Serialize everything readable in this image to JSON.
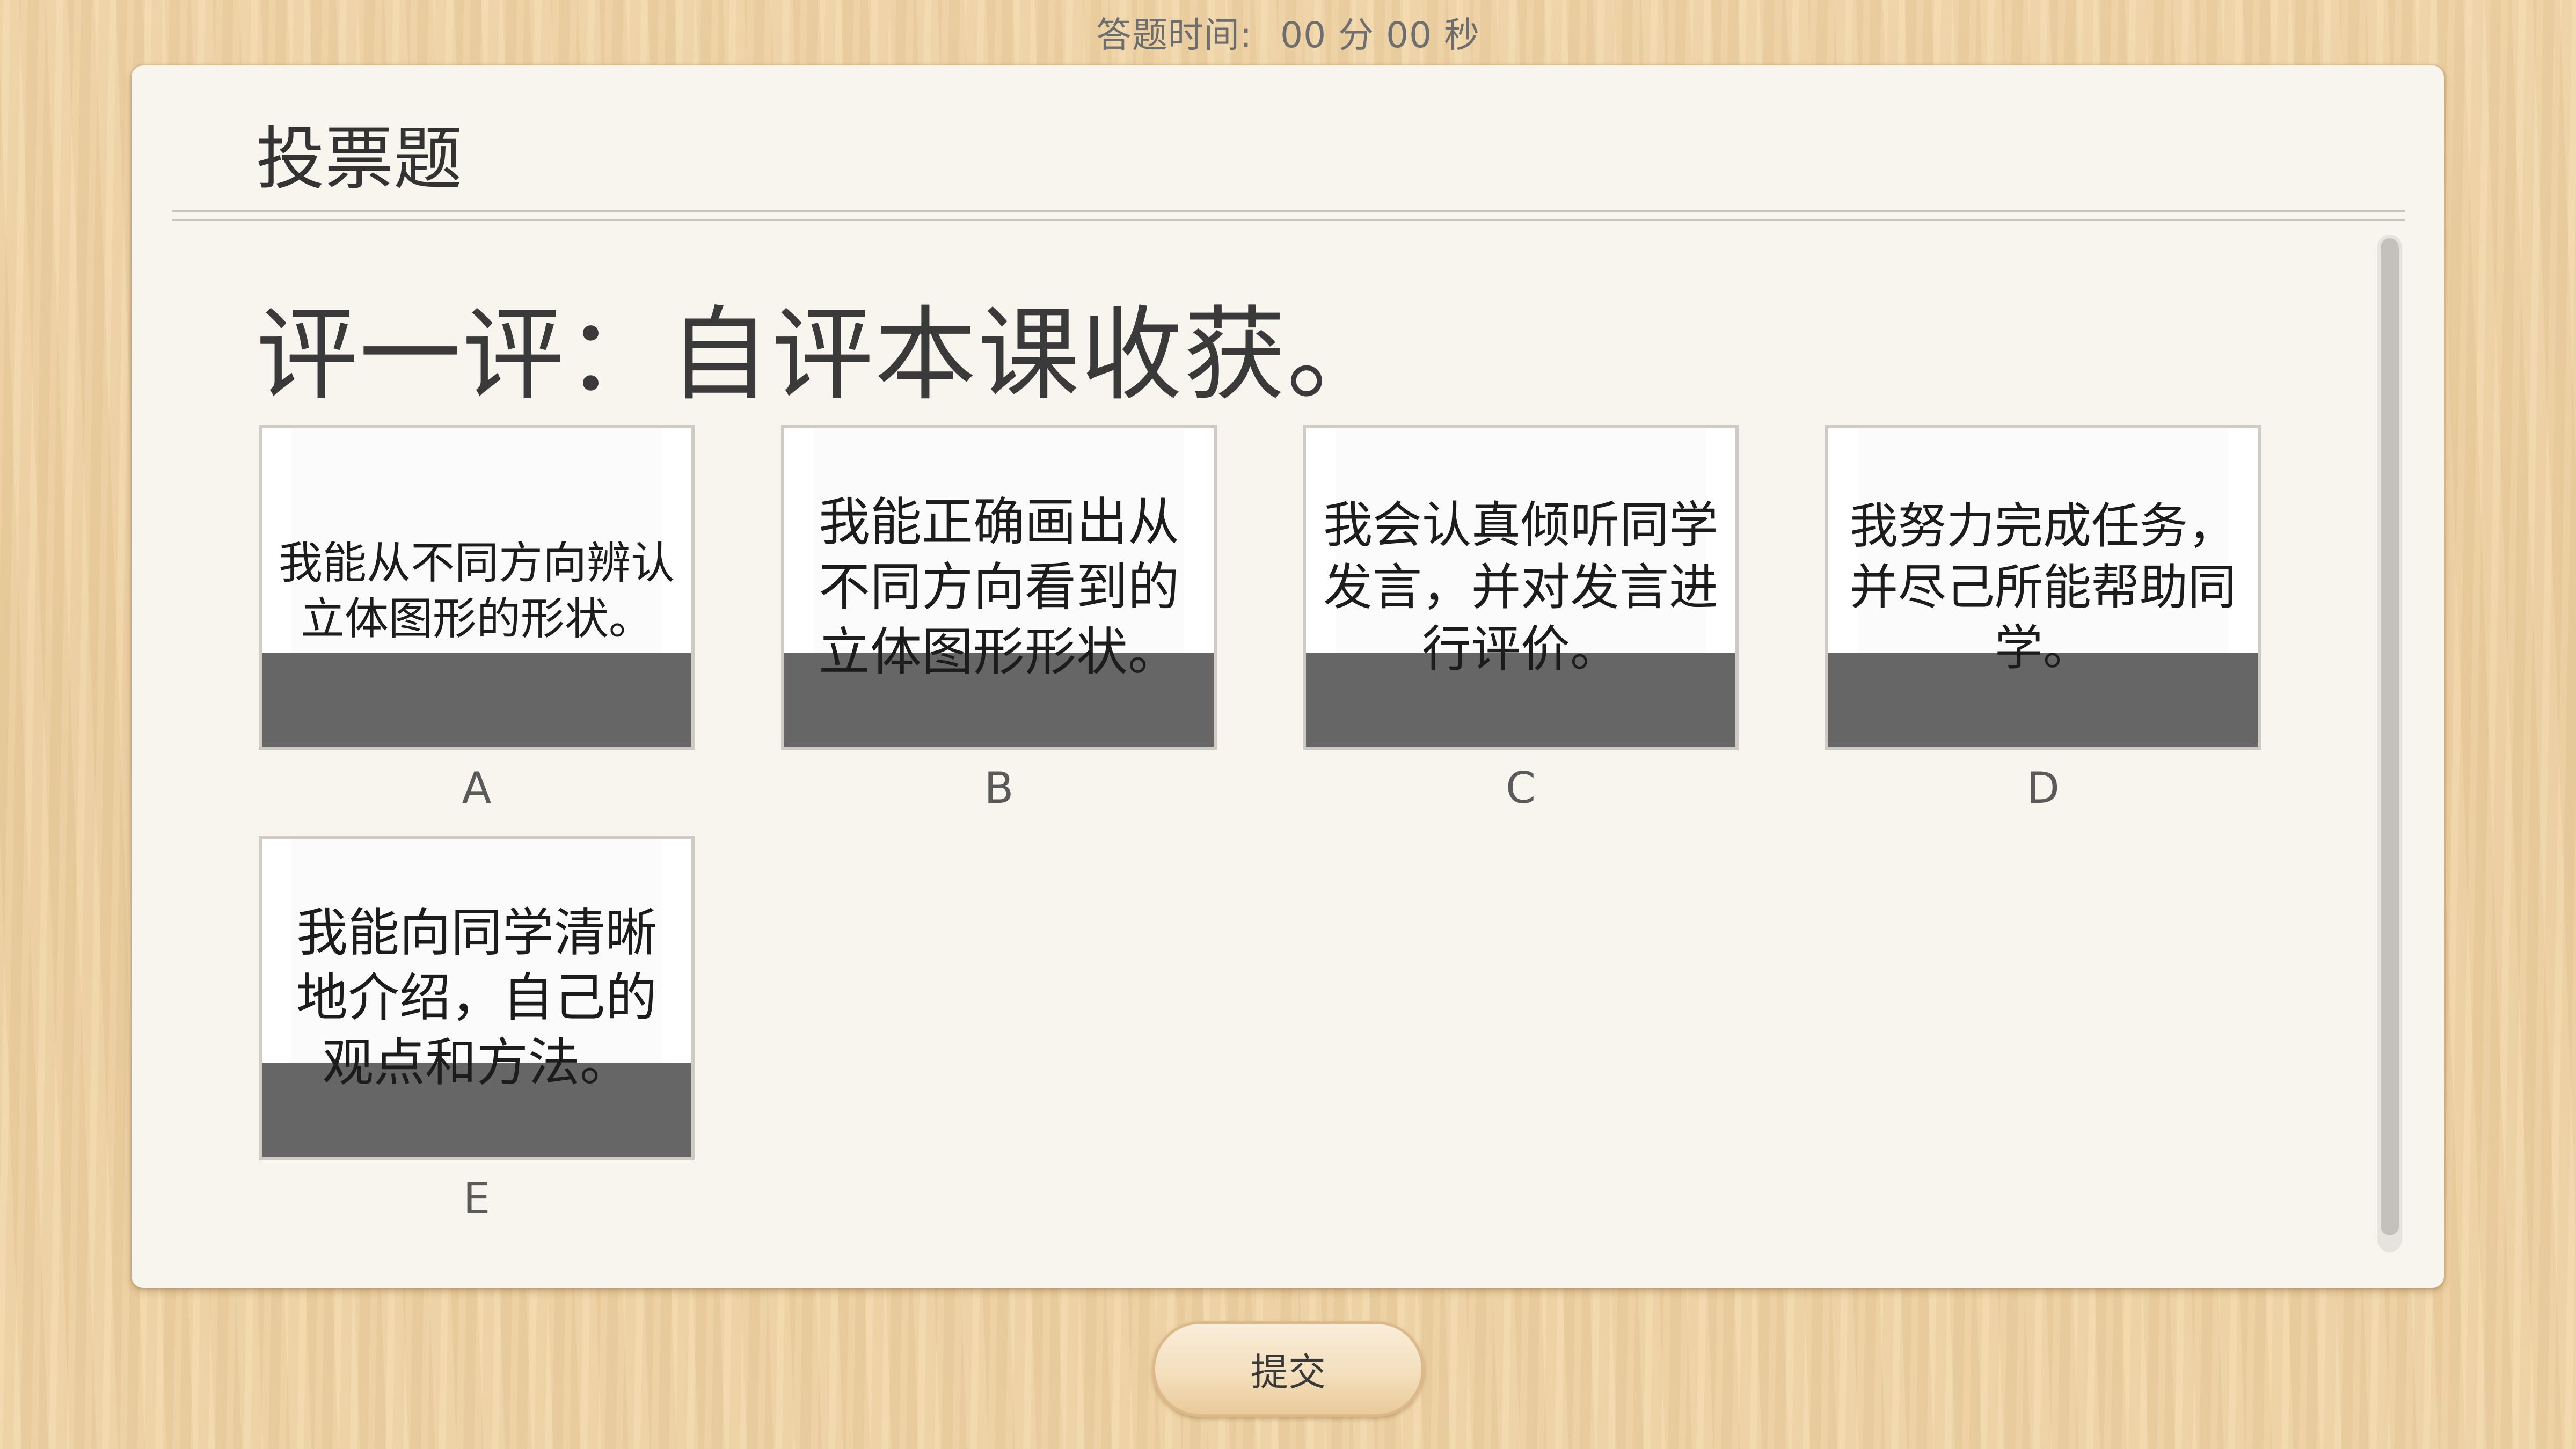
{
  "timer": {
    "label": "答题时间:",
    "value": "00 分 00 秒"
  },
  "panel": {
    "title": "投票题",
    "question": "评一评：自评本课收获。"
  },
  "options": [
    {
      "label": "A",
      "text": "我能从不同方向辨认立体图形的形状。"
    },
    {
      "label": "B",
      "text": "我能正确画出从不同方向看到的立体图形形状。"
    },
    {
      "label": "C",
      "text": "我会认真倾听同学发言，并对发言进行评价。"
    },
    {
      "label": "D",
      "text": "我努力完成任务，并尽己所能帮助同学。"
    },
    {
      "label": "E",
      "text": "我能向同学清晰地介绍，自己的观点和方法。"
    }
  ],
  "submit": {
    "label": "提交"
  },
  "colors": {
    "background_wood": "#efd2a3",
    "panel": "#f8f4ee",
    "option_shade": "#666666"
  }
}
